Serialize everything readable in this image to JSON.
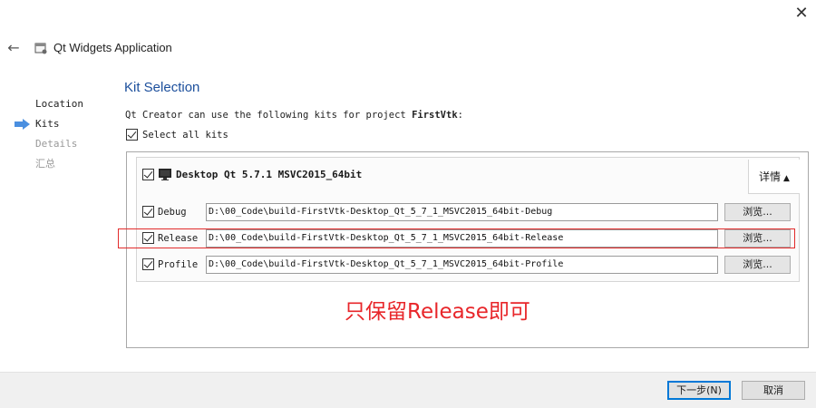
{
  "window": {
    "close_glyph": "✕",
    "back_glyph": "←",
    "title": "Qt Widgets Application"
  },
  "steps": [
    {
      "label": "Location",
      "state": "done"
    },
    {
      "label": "Kits",
      "state": "current"
    },
    {
      "label": "Details",
      "state": "pending"
    },
    {
      "label": "汇总",
      "state": "pending"
    }
  ],
  "page": {
    "title": "Kit Selection",
    "intro_prefix": "Qt Creator can use the following kits for project ",
    "project_name": "FirstVtk",
    "intro_suffix": ":",
    "select_all_label": "Select all kits",
    "select_all_checked": true
  },
  "kit": {
    "name": "Desktop Qt 5.7.1 MSVC2015_64bit",
    "checked": true,
    "details_label": "详情",
    "details_glyph": "▲",
    "builds": [
      {
        "name": "Debug",
        "checked": true,
        "path": "D:\\00_Code\\build-FirstVtk-Desktop_Qt_5_7_1_MSVC2015_64bit-Debug",
        "browse_label": "浏览..."
      },
      {
        "name": "Release",
        "checked": true,
        "path": "D:\\00_Code\\build-FirstVtk-Desktop_Qt_5_7_1_MSVC2015_64bit-Release",
        "browse_label": "浏览..."
      },
      {
        "name": "Profile",
        "checked": true,
        "path": "D:\\00_Code\\build-FirstVtk-Desktop_Qt_5_7_1_MSVC2015_64bit-Profile",
        "browse_label": "浏览..."
      }
    ]
  },
  "annotation": {
    "text": "只保留Release即可",
    "color": "#e8262a"
  },
  "footer": {
    "next_label": "下一步(N)",
    "cancel_label": "取消"
  },
  "colors": {
    "title_blue": "#1c4f9c",
    "step_arrow": "#4a8fe0",
    "highlight_red": "#e22b2b"
  }
}
